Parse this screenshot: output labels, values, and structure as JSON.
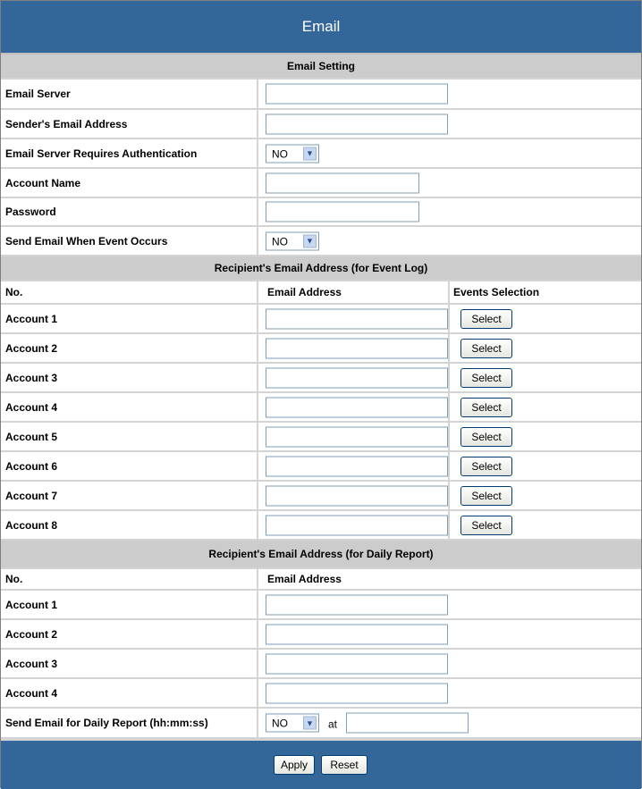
{
  "header": {
    "title": "Email"
  },
  "email_setting": {
    "section_title": "Email Setting",
    "email_server_label": "Email Server",
    "email_server_value": "",
    "sender_label": "Sender's Email Address",
    "sender_value": "",
    "auth_label": "Email Server Requires Authentication",
    "auth_value": "NO",
    "account_name_label": "Account Name",
    "account_name_value": "",
    "password_label": "Password",
    "password_value": "",
    "send_on_event_label": "Send Email When Event Occurs",
    "send_on_event_value": "NO"
  },
  "event_log": {
    "section_title": "Recipient's Email Address (for Event Log)",
    "col_no": "No.",
    "col_email": "Email Address",
    "col_events": "Events Selection",
    "select_label": "Select",
    "accounts": [
      {
        "label": "Account 1",
        "email": ""
      },
      {
        "label": "Account 2",
        "email": ""
      },
      {
        "label": "Account 3",
        "email": ""
      },
      {
        "label": "Account 4",
        "email": ""
      },
      {
        "label": "Account 5",
        "email": ""
      },
      {
        "label": "Account 6",
        "email": ""
      },
      {
        "label": "Account 7",
        "email": ""
      },
      {
        "label": "Account 8",
        "email": ""
      }
    ]
  },
  "daily_report": {
    "section_title": "Recipient's Email Address (for Daily Report)",
    "col_no": "No.",
    "col_email": "Email Address",
    "accounts": [
      {
        "label": "Account 1",
        "email": ""
      },
      {
        "label": "Account 2",
        "email": ""
      },
      {
        "label": "Account 3",
        "email": ""
      },
      {
        "label": "Account 4",
        "email": ""
      }
    ],
    "send_daily_label": "Send Email for Daily Report (hh:mm:ss)",
    "send_daily_value": "NO",
    "at_label": "at",
    "time_value": ""
  },
  "footer": {
    "apply_label": "Apply",
    "reset_label": "Reset"
  },
  "colors": {
    "header_bg": "#336699",
    "section_bg": "#cccccc",
    "border": "#d4d4d4"
  }
}
